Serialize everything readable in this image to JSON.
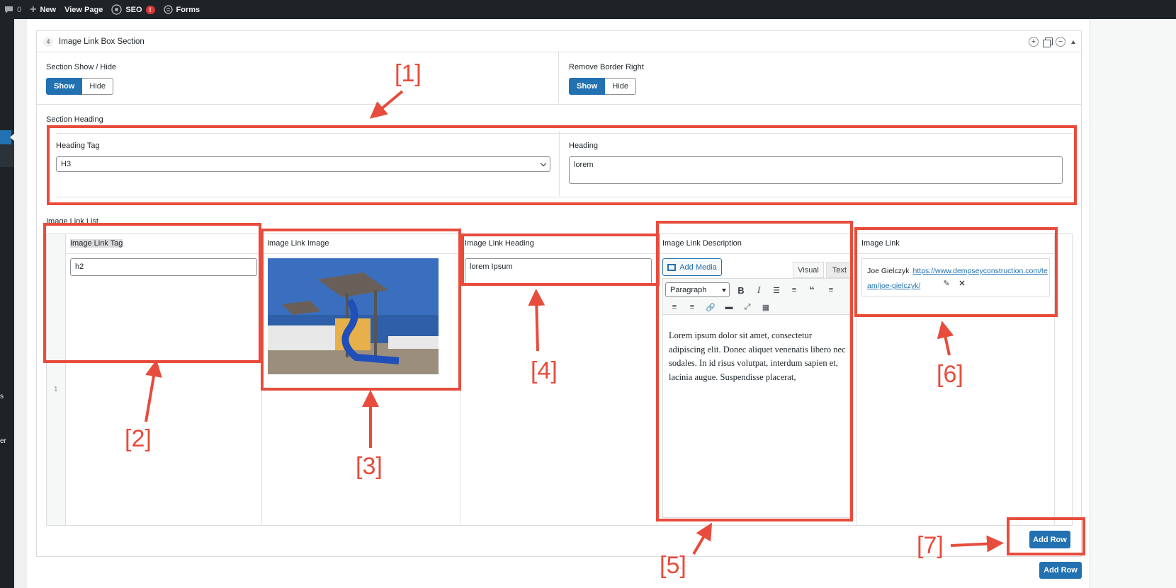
{
  "adminbar": {
    "comments_count": "0",
    "new_label": "New",
    "view_page_label": "View Page",
    "seo_label": "SEO",
    "seo_badge": "!",
    "forms_label": "Forms"
  },
  "sidebar_fragments": [
    "s",
    "er"
  ],
  "panel": {
    "number": "4",
    "title": "Image Link Box Section"
  },
  "section_show_hide": {
    "label": "Section Show / Hide",
    "show": "Show",
    "hide": "Hide"
  },
  "remove_border_right": {
    "label": "Remove Border Right",
    "show": "Show",
    "hide": "Hide"
  },
  "section_heading": {
    "label": "Section Heading",
    "heading_tag_label": "Heading Tag",
    "heading_tag_value": "H3",
    "heading_label": "Heading",
    "heading_value": "lorem"
  },
  "image_link_list": {
    "label": "Image Link List",
    "columns": [
      "Image Link Tag",
      "Image Link Image",
      "Image Link Heading",
      "Image Link Description",
      "Image Link"
    ],
    "row_number": "1",
    "tag_value": "h2",
    "heading_value": "lorem Ipsum",
    "editor": {
      "add_media": "Add Media",
      "tab_visual": "Visual",
      "tab_text": "Text",
      "format": "Paragraph",
      "content": "Lorem ipsum dolor sit amet, consectetur adipiscing elit. Donec aliquet venenatis libero nec sodales. In id risus volutpat, interdum sapien et, lacinia augue. Suspendisse placerat,"
    },
    "link": {
      "name": "Joe Gielczyk",
      "url": "https://www.dempseyconstruction.com/team/joe-gielczyk/"
    },
    "add_row_inner": "Add Row",
    "add_row_outer": "Add Row"
  },
  "annotations": [
    "[1]",
    "[2]",
    "[3]",
    "[4]",
    "[5]",
    "[6]",
    "[7]"
  ],
  "colors": {
    "accent": "#2271b1",
    "annotation": "#e74c3c",
    "adminbar": "#1d2327"
  }
}
